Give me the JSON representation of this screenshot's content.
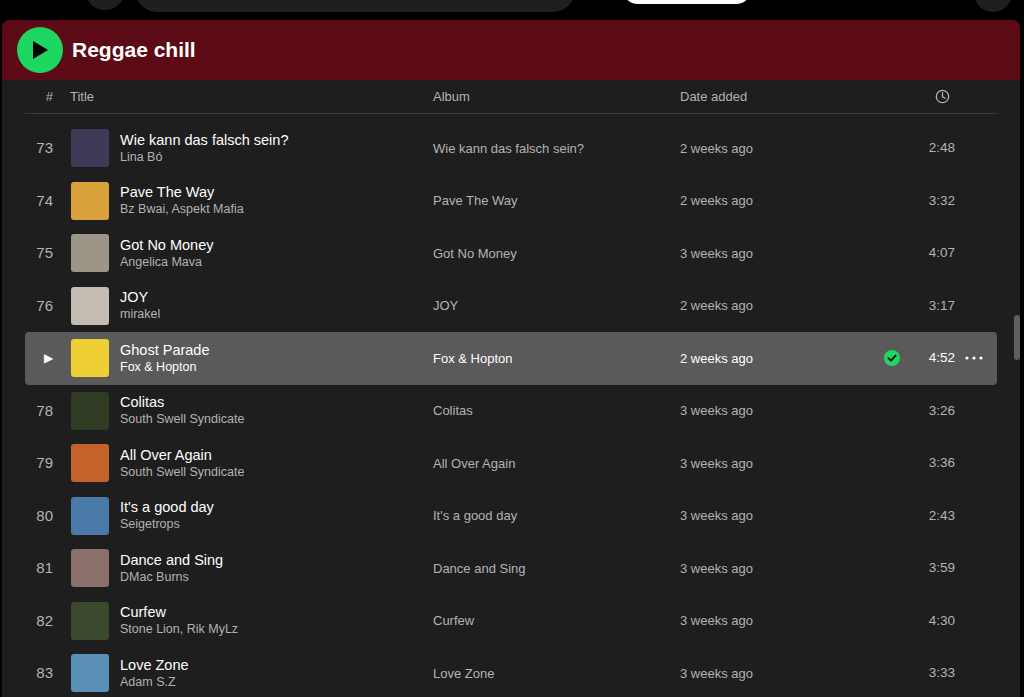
{
  "header": {
    "title": "Reggae chill"
  },
  "columns": [
    {
      "label": "#"
    },
    {
      "label": "Title"
    },
    {
      "label": "Album"
    },
    {
      "label": "Date added"
    }
  ],
  "rows": [
    {
      "number": "73",
      "title": "Wie kann das falsch sein?",
      "artists": "Lina Bó",
      "album": "Wie kann das falsch sein?",
      "date_added": "2 weeks ago",
      "duration": "2:48",
      "hovered": false,
      "saved": false,
      "color": "#3d3b58"
    },
    {
      "number": "74",
      "title": "Pave The Way",
      "artists": "Bz Bwai, Aspekt Mafia",
      "album": "Pave The Way",
      "date_added": "2 weeks ago",
      "duration": "3:32",
      "hovered": false,
      "saved": false,
      "color": "#d9a23a"
    },
    {
      "number": "75",
      "title": "Got No Money",
      "artists": "Angelica Mava",
      "album": "Got No Money",
      "date_added": "3 weeks ago",
      "duration": "4:07",
      "hovered": false,
      "saved": false,
      "color": "#9c9588"
    },
    {
      "number": "76",
      "title": "JOY",
      "artists": "mirakel",
      "album": "JOY",
      "date_added": "2 weeks ago",
      "duration": "3:17",
      "hovered": false,
      "saved": false,
      "color": "#c4bcb2"
    },
    {
      "number": "▶",
      "title": "Ghost Parade",
      "artists": "Fox & Hopton",
      "album": "Fox & Hopton",
      "date_added": "2 weeks ago",
      "duration": "4:52",
      "hovered": true,
      "saved": true,
      "color": "#f0cf34"
    },
    {
      "number": "78",
      "title": "Colitas",
      "artists": "South Swell Syndicate",
      "album": "Colitas",
      "date_added": "3 weeks ago",
      "duration": "3:26",
      "hovered": false,
      "saved": false,
      "color": "#2f3b22"
    },
    {
      "number": "79",
      "title": "All Over Again",
      "artists": "South Swell Syndicate",
      "album": "All Over Again",
      "date_added": "3 weeks ago",
      "duration": "3:36",
      "hovered": false,
      "saved": false,
      "color": "#c4622c"
    },
    {
      "number": "80",
      "title": "It's a good day",
      "artists": "Seigetrops",
      "album": "It's a good day",
      "date_added": "3 weeks ago",
      "duration": "2:43",
      "hovered": false,
      "saved": false,
      "color": "#4a7aa8"
    },
    {
      "number": "81",
      "title": "Dance and Sing",
      "artists": "DMac Burns",
      "album": "Dance and Sing",
      "date_added": "3 weeks ago",
      "duration": "3:59",
      "hovered": false,
      "saved": false,
      "color": "#8a6f6a"
    },
    {
      "number": "82",
      "title": "Curfew",
      "artists": "Stone Lion, Rik MyLz",
      "album": "Curfew",
      "date_added": "3 weeks ago",
      "duration": "4:30",
      "hovered": false,
      "saved": false,
      "color": "#3b4a2c"
    },
    {
      "number": "83",
      "title": "Love Zone",
      "artists": "Adam S.Z",
      "album": "Love Zone",
      "date_added": "3 weeks ago",
      "duration": "3:33",
      "hovered": false,
      "saved": false,
      "color": "#5a90b8"
    }
  ]
}
